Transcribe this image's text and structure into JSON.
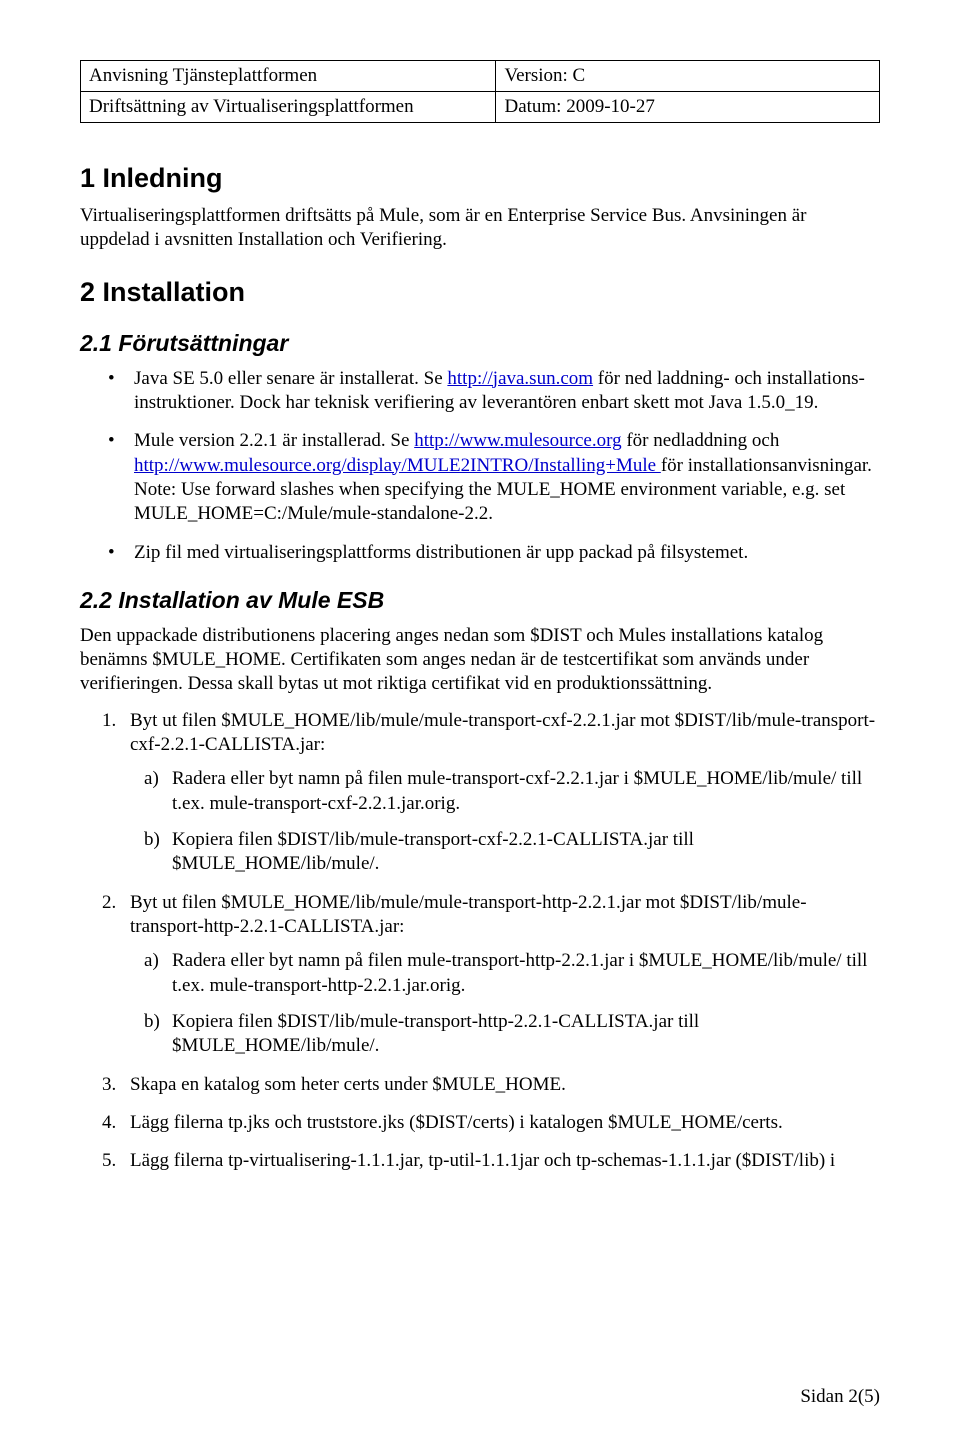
{
  "meta": {
    "r1c1": "Anvisning Tjänsteplattformen",
    "r1c2": "Version: C",
    "r2c1": "Driftsättning av Virtualiseringsplattformen",
    "r2c2": "Datum: 2009-10-27"
  },
  "section1": {
    "heading": "1  Inledning",
    "para": "Virtualiseringsplattformen driftsätts på Mule, som är en Enterprise Service Bus. Anvsiningen är uppdelad i avsnitten Installation och Verifiering."
  },
  "section2": {
    "heading": "2  Installation",
    "sub1": {
      "heading": "2.1  Förutsättningar",
      "bullet1_a": "Java SE 5.0 eller senare är installerat. Se ",
      "bullet1_link": "http://java.sun.com",
      "bullet1_b": " för ned laddning- och installations- instruktioner. Dock har teknisk verifiering av leverantören enbart skett mot Java 1.5.0_19.",
      "bullet2_a": "Mule version 2.2.1 är installerad. Se ",
      "bullet2_link1": "http://www.mulesource.org",
      "bullet2_b": " för nedladdning och ",
      "bullet2_link2": "http://www.mulesource.org/display/MULE2INTRO/Installing+Mule ",
      "bullet2_c": " för installationsanvisningar.",
      "bullet2_note": "Note: Use forward slashes when specifying the MULE_HOME environment variable, e.g. set MULE_HOME=C:/Mule/mule-standalone-2.2.",
      "bullet3": "Zip fil med virtualiseringsplattforms distributionen är upp packad på filsystemet."
    },
    "sub2": {
      "heading": "2.2  Installation av Mule ESB",
      "para": "Den uppackade distributionens placering anges nedan som $DIST och Mules installations katalog benämns $MULE_HOME. Certifikaten som anges nedan är de testcertifikat som används under verifieringen. Dessa skall bytas ut mot riktiga certifikat vid en produktionssättning.",
      "step1": "Byt ut filen $MULE_HOME/lib/mule/mule-transport-cxf-2.2.1.jar mot $DIST/lib/mule-transport-cxf-2.2.1-CALLISTA.jar:",
      "step1a": "Radera eller byt namn på filen mule-transport-cxf-2.2.1.jar i $MULE_HOME/lib/mule/ till t.ex. mule-transport-cxf-2.2.1.jar.orig.",
      "step1b": "Kopiera filen $DIST/lib/mule-transport-cxf-2.2.1-CALLISTA.jar till $MULE_HOME/lib/mule/.",
      "step2": "Byt ut filen $MULE_HOME/lib/mule/mule-transport-http-2.2.1.jar mot $DIST/lib/mule-transport-http-2.2.1-CALLISTA.jar:",
      "step2a": "Radera eller byt namn på filen mule-transport-http-2.2.1.jar i $MULE_HOME/lib/mule/ till t.ex. mule-transport-http-2.2.1.jar.orig.",
      "step2b": "Kopiera filen $DIST/lib/mule-transport-http-2.2.1-CALLISTA.jar till $MULE_HOME/lib/mule/.",
      "step3": "Skapa en katalog som heter certs under $MULE_HOME.",
      "step4": "Lägg filerna tp.jks och truststore.jks ($DIST/certs) i katalogen $MULE_HOME/certs.",
      "step5": "Lägg filerna tp-virtualisering-1.1.1.jar, tp-util-1.1.1jar och tp-schemas-1.1.1.jar ($DIST/lib) i"
    }
  },
  "footer": "Sidan 2(5)"
}
